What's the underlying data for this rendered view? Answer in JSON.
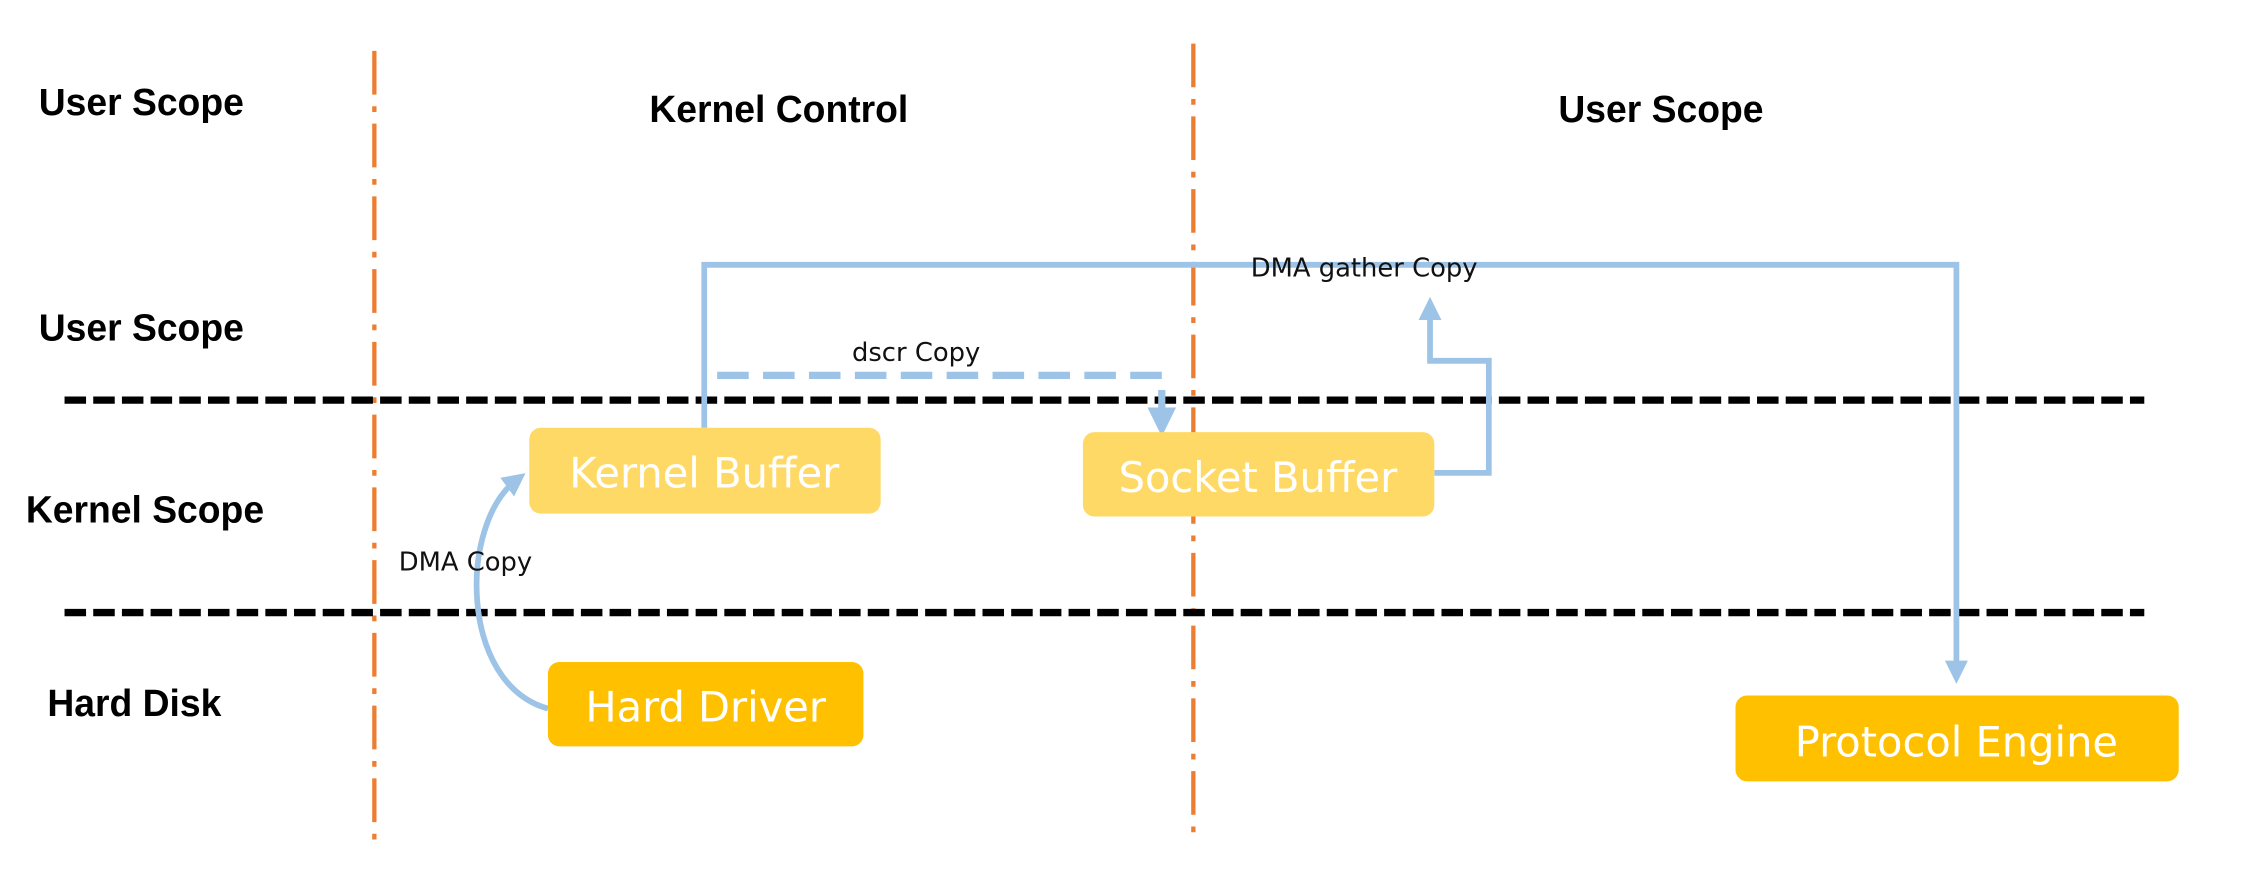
{
  "colors": {
    "boundary_vertical": "#ED7D31",
    "boundary_horizontal": "#000000",
    "buffer_fill": "#FFD966",
    "device_fill": "#FFC000",
    "arrow": "#9DC3E6"
  },
  "row_labels": [
    "User Scope",
    "User Scope",
    "Kernel Scope",
    "Hard Disk"
  ],
  "column_headers": [
    "Kernel Control",
    "User Scope"
  ],
  "nodes": {
    "kernel_buffer": "Kernel Buffer",
    "socket_buffer": "Socket Buffer",
    "hard_driver": "Hard Driver",
    "protocol_engine": "Protocol Engine"
  },
  "edges": {
    "dma_copy": "DMA Copy",
    "dscr_copy": "dscr Copy",
    "dma_gather_copy": "DMA gather Copy"
  }
}
